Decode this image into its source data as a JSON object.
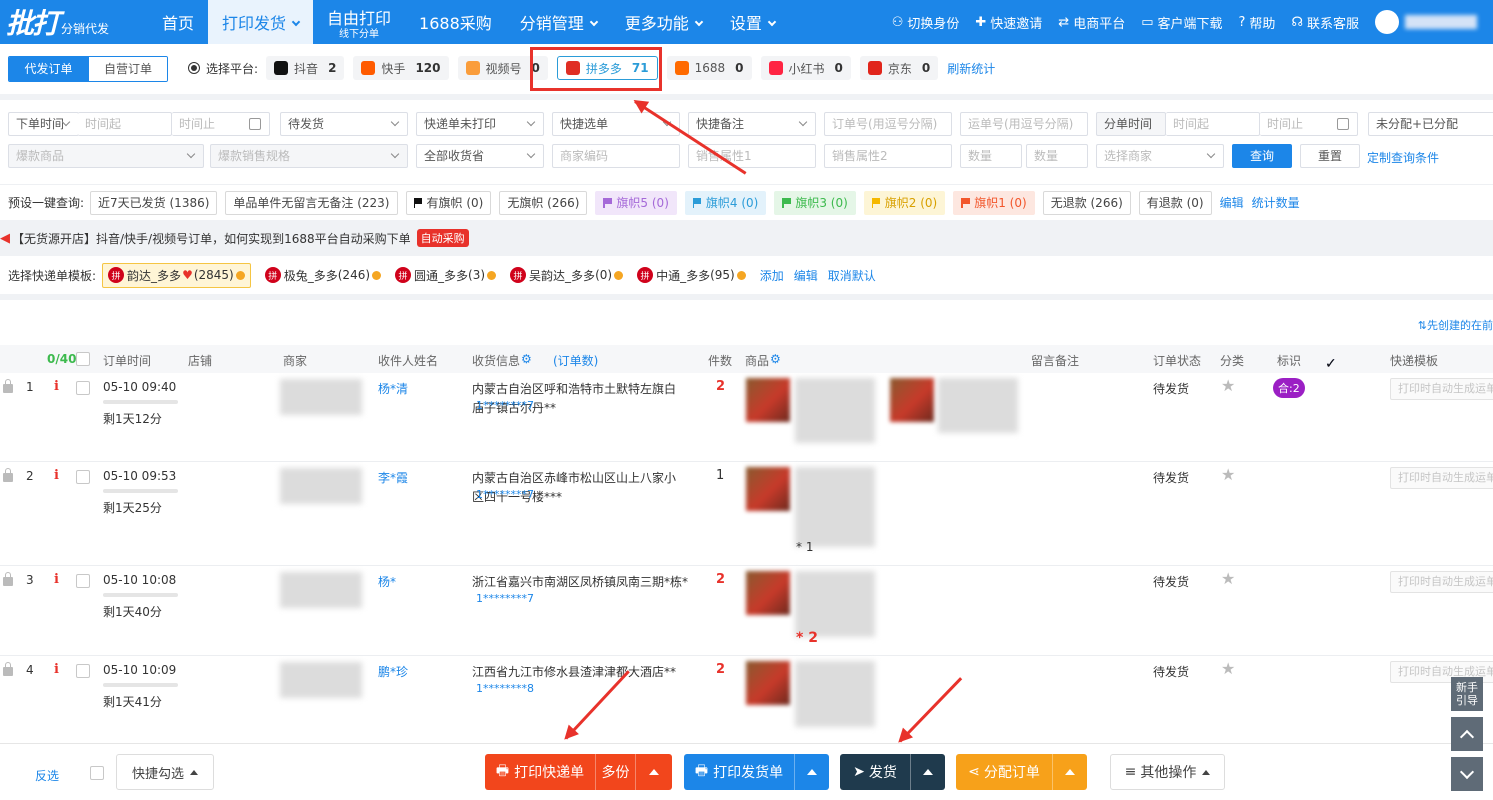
{
  "logo": {
    "big": "批打",
    "small": "分销代发"
  },
  "nav": [
    {
      "label": "首页",
      "sub": "",
      "caret": false,
      "active": false
    },
    {
      "label": "打印发货",
      "sub": "",
      "caret": true,
      "active": true
    },
    {
      "label": "自由打印",
      "sub": "线下分单",
      "caret": false,
      "active": false
    },
    {
      "label": "1688采购",
      "sub": "",
      "caret": false,
      "active": false
    },
    {
      "label": "分销管理",
      "sub": "",
      "caret": true,
      "active": false
    },
    {
      "label": "更多功能",
      "sub": "",
      "caret": true,
      "active": false
    },
    {
      "label": "设置",
      "sub": "",
      "caret": true,
      "active": false
    }
  ],
  "header_right": [
    {
      "label": "切换身份",
      "icon": "user-switch-icon"
    },
    {
      "label": "快速邀请",
      "icon": "invite-icon"
    },
    {
      "label": "电商平台",
      "icon": "swap-icon"
    },
    {
      "label": "客户端下载",
      "icon": "monitor-icon"
    },
    {
      "label": "帮助",
      "icon": "help-icon"
    },
    {
      "label": "联系客服",
      "icon": "headset-icon"
    }
  ],
  "order_tabs": [
    "代发订单",
    "自营订单"
  ],
  "platform": {
    "label": "选择平台:",
    "chips": [
      {
        "name": "抖音",
        "count": "2",
        "color": "#111111"
      },
      {
        "name": "快手",
        "count": "120",
        "color": "#ff5b00"
      },
      {
        "name": "视频号",
        "count": "0",
        "color": "#fa9d3b"
      },
      {
        "name": "拼多多",
        "count": "71",
        "color": "#e02e24",
        "selected": true
      },
      {
        "name": "1688",
        "count": "0",
        "color": "#ff6a00"
      },
      {
        "name": "小红书",
        "count": "0",
        "color": "#ff2442"
      },
      {
        "name": "京东",
        "count": "0",
        "color": "#e1251b"
      }
    ],
    "refresh": "刷新统计"
  },
  "filters": {
    "order_time": "下单时间",
    "time_from": "时间起",
    "time_to": "时间止",
    "status": "待发货",
    "print_status": "快递单未打印",
    "quick_pick": "快捷选单",
    "quick_note": "快捷备注",
    "order_no": "订单号(用逗号分隔)",
    "waybill_no": "运单号(用逗号分隔)",
    "split_time": "分单时间",
    "split_from": "时间起",
    "split_to": "时间止",
    "assign": "未分配+已分配",
    "hot_goods": "爆款商品",
    "hot_spec": "爆款销售规格",
    "province": "全部收货省",
    "merchant_code": "商家编码",
    "sale_attr1": "销售属性1",
    "sale_attr2": "销售属性2",
    "qty_from": "数量",
    "qty_to": "数量",
    "select_merchant": "选择商家",
    "query": "查询",
    "reset": "重置",
    "custom": "定制查询条件"
  },
  "presets": {
    "label": "预设一键查询:",
    "items": [
      {
        "label": "近7天已发货 (1386)",
        "flag": ""
      },
      {
        "label": "单品单件无留言无备注 (223)",
        "flag": ""
      },
      {
        "label": "有旗帜 (0)",
        "flag": "#111111"
      },
      {
        "label": "无旗帜 (266)",
        "flag": ""
      },
      {
        "label": "旗帜5 (0)",
        "flag": "#a569d8",
        "bg": "#f1e6fa",
        "fg": "#a569d8"
      },
      {
        "label": "旗帜4 (0)",
        "flag": "#2b9cd8",
        "bg": "#e3f2fb",
        "fg": "#2b9cd8"
      },
      {
        "label": "旗帜3 (0)",
        "flag": "#3dba4e",
        "bg": "#e5f6e7",
        "fg": "#3dba4e"
      },
      {
        "label": "旗帜2 (0)",
        "flag": "#f5b800",
        "bg": "#fdf5d6",
        "fg": "#d8a000"
      },
      {
        "label": "旗帜1 (0)",
        "flag": "#f2562b",
        "bg": "#fde7e0",
        "fg": "#f2562b"
      },
      {
        "label": "无退款 (266)",
        "flag": ""
      },
      {
        "label": "有退款 (0)",
        "flag": ""
      }
    ],
    "edit": "编辑",
    "stats": "统计数量"
  },
  "notice": {
    "text": "【无货源开店】抖音/快手/视频号订单，如何实现到1688平台自动采购下单",
    "badge": "自动采购"
  },
  "templates": {
    "label": "选择快递单模板:",
    "items": [
      {
        "label": "韵达_多多",
        "extra": "(2845)",
        "selected": true
      },
      {
        "label": "极兔_多多",
        "extra": "(246)"
      },
      {
        "label": "圆通_多多",
        "extra": "(3)"
      },
      {
        "label": "吴韵达_多多",
        "extra": "(0)"
      },
      {
        "label": "中通_多多",
        "extra": "(95)"
      }
    ],
    "icon_text": "拼",
    "add": "添加",
    "edit": "编辑",
    "cancel_default": "取消默认"
  },
  "sort_hint": "先创建的在前",
  "table": {
    "count": "0/40",
    "headers": {
      "time": "订单时间",
      "shop": "店铺",
      "merchant": "商家",
      "receiver": "收件人姓名",
      "address": "收货信息",
      "order_count": "(订单数)",
      "qty": "件数",
      "goods": "商品",
      "memo": "留言备注",
      "state": "订单状态",
      "category": "分类",
      "mark": "标识",
      "express": "快递模板"
    },
    "rows": [
      {
        "no": "1",
        "time": "05-10 09:40",
        "remain": "剩1天12分",
        "name": "杨*清",
        "addr1": "内蒙古自治区呼和浩特市土默特左旗白",
        "addr2": "庙子镇古尔丹**",
        "phone": "1********7",
        "qty": "2",
        "qty_red": true,
        "status": "待发货",
        "badge": "合:2",
        "express": "打印时自动生成运单",
        "goods_qty": ""
      },
      {
        "no": "2",
        "time": "05-10 09:53",
        "remain": "剩1天25分",
        "name": "李*霞",
        "addr1": "内蒙古自治区赤峰市松山区山上八家小",
        "addr2": "区四十一号楼***",
        "phone": "1********7",
        "qty": "1",
        "qty_red": false,
        "status": "待发货",
        "badge": "",
        "express": "打印时自动生成运单",
        "goods_qty": "* 1"
      },
      {
        "no": "3",
        "time": "05-10 10:08",
        "remain": "剩1天40分",
        "name": "杨*",
        "addr1": "浙江省嘉兴市南湖区凤桥镇凤南三期*栋*",
        "addr2": "",
        "phone": "1********7",
        "qty": "2",
        "qty_red": true,
        "status": "待发货",
        "badge": "",
        "express": "打印时自动生成运单",
        "goods_qty": "* 2"
      },
      {
        "no": "4",
        "time": "05-10 10:09",
        "remain": "剩1天41分",
        "name": "鹏*珍",
        "addr1": "江西省九江市修水县渣津津都大酒店**",
        "addr2": "",
        "phone": "1********8",
        "qty": "2",
        "qty_red": true,
        "status": "待发货",
        "badge": "",
        "express": "打印时自动生成运单",
        "goods_qty": ""
      }
    ]
  },
  "bottom": {
    "invert": "反选",
    "quick_check": "快捷勾选",
    "print_express": "打印快递单",
    "multi": "多份",
    "print_invoice": "打印发货单",
    "ship": "发货",
    "assign": "分配订单",
    "other": "其他操作"
  },
  "side": {
    "guide": "新手引导"
  },
  "colors": {
    "primary": "#1c86e8",
    "print": "#f2461c",
    "ship": "#1f3a4d",
    "assign": "#f7a11a",
    "annotation": "#e8322b"
  }
}
